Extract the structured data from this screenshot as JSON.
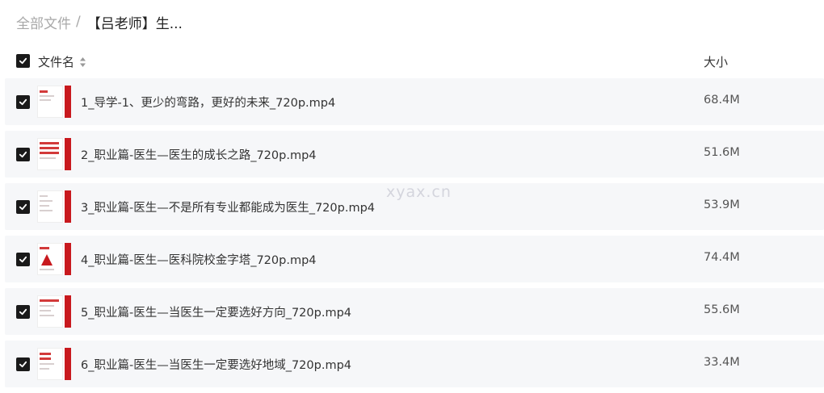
{
  "breadcrumb": {
    "root": "全部文件",
    "separator": "/",
    "current": "【吕老师】生..."
  },
  "header": {
    "name_label": "文件名",
    "size_label": "大小"
  },
  "files": [
    {
      "name": "1_导学-1、更少的弯路，更好的未来_720p.mp4",
      "size": "68.4M"
    },
    {
      "name": "2_职业篇-医生—医生的成长之路_720p.mp4",
      "size": "51.6M"
    },
    {
      "name": "3_职业篇-医生—不是所有专业都能成为医生_720p.mp4",
      "size": "53.9M"
    },
    {
      "name": "4_职业篇-医生—医科院校金字塔_720p.mp4",
      "size": "74.4M"
    },
    {
      "name": "5_职业篇-医生—当医生一定要选好方向_720p.mp4",
      "size": "55.6M"
    },
    {
      "name": "6_职业篇-医生—当医生一定要选好地域_720p.mp4",
      "size": "33.4M"
    }
  ],
  "watermark": "xyax.cn",
  "colors": {
    "checkbox": "#1a1a1a",
    "row_bg": "#f6f7f9",
    "thumb_accent": "#c8191e"
  },
  "icons": {
    "checkbox": "check-icon",
    "sort": "sort-icon"
  }
}
